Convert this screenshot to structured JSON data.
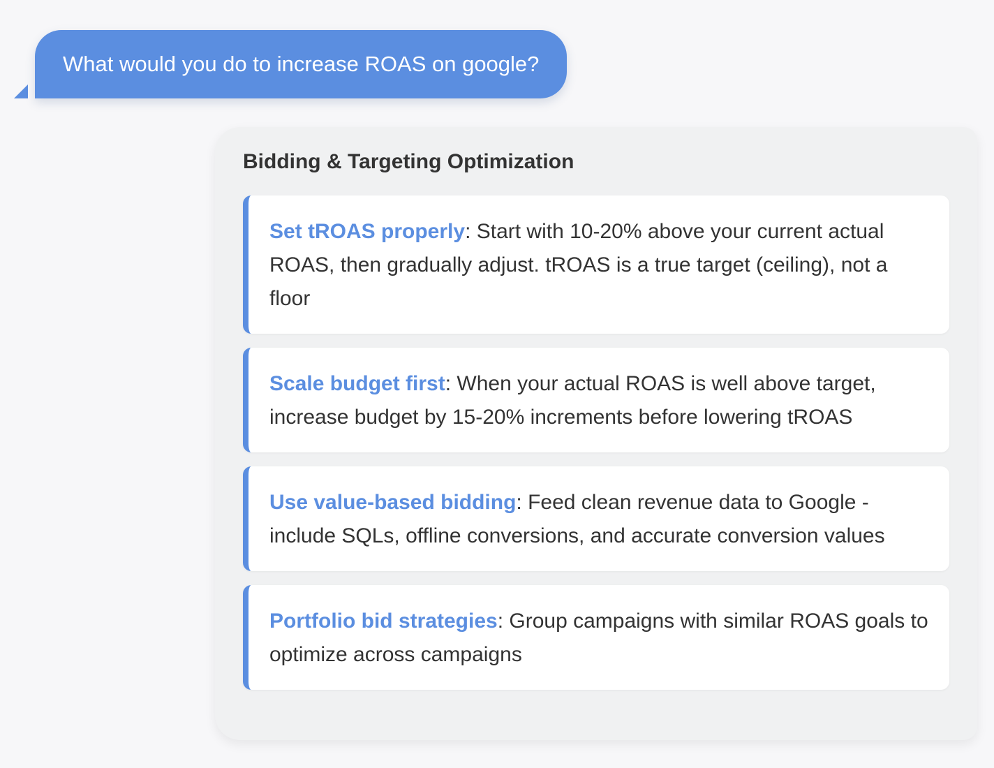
{
  "user_message": "What would you do to increase ROAS on google?",
  "assistant": {
    "section_title": "Bidding & Targeting Optimization",
    "tips": [
      {
        "title": "Set tROAS properly",
        "text": ": Start with 10-20% above your current actual ROAS, then gradually adjust. tROAS is a true target (ceiling), not a floor"
      },
      {
        "title": "Scale budget first",
        "text": ": When your actual ROAS is well above target, increase budget by 15-20% increments before lowering tROAS"
      },
      {
        "title": "Use value-based bidding",
        "text": ": Feed clean revenue data to Google - include SQLs, offline conversions, and accurate conversion values"
      },
      {
        "title": "Portfolio bid strategies",
        "text": ": Group campaigns with similar ROAS goals to optimize across campaigns"
      }
    ]
  },
  "colors": {
    "accent": "#5b8ee0",
    "background": "#f7f7f9",
    "card_background": "#f0f1f2",
    "tip_background": "#ffffff",
    "text": "#333333"
  }
}
